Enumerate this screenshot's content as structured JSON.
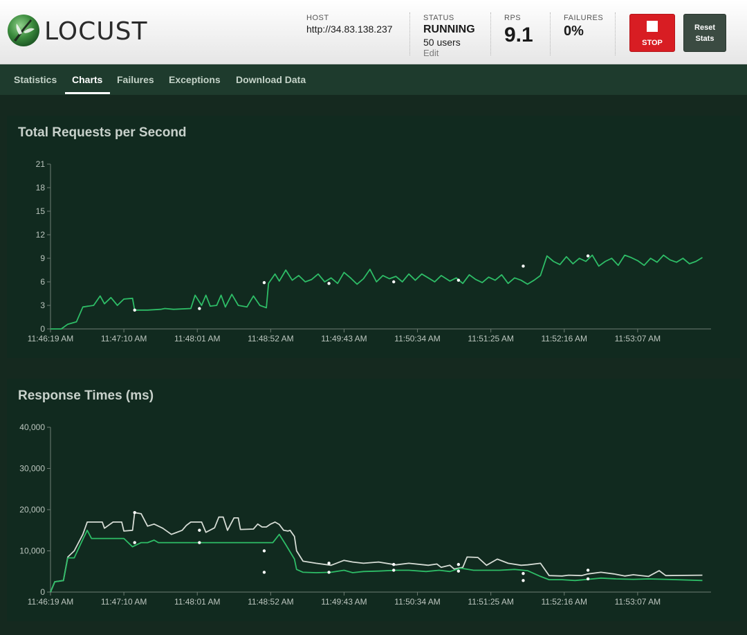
{
  "header": {
    "logo_text": "LOCUST",
    "host_label": "HOST",
    "host_value": "http://34.83.138.237",
    "status_label": "STATUS",
    "status_value": "RUNNING",
    "users_value": "50 users",
    "edit_label": "Edit",
    "rps_label": "RPS",
    "rps_value": "9.1",
    "failures_label": "FAILURES",
    "failures_value": "0%",
    "stop_label": "STOP",
    "reset_label_line1": "Reset",
    "reset_label_line2": "Stats"
  },
  "colors": {
    "rps_line": "#2ebd67",
    "median_line": "#2ebd67",
    "p95_line": "#d6dcd5",
    "stop_button": "#d81d23",
    "nav_bg": "#1e3b2d",
    "panel_bg": "#112a1f"
  },
  "nav": {
    "tabs": [
      {
        "label": "Statistics",
        "active": false
      },
      {
        "label": "Charts",
        "active": true
      },
      {
        "label": "Failures",
        "active": false
      },
      {
        "label": "Exceptions",
        "active": false
      },
      {
        "label": "Download Data",
        "active": false
      }
    ]
  },
  "chart_data": [
    {
      "type": "line",
      "title": "Total Requests per Second",
      "ylim": [
        0,
        21
      ],
      "yticks": [
        0,
        3,
        6,
        9,
        12,
        15,
        18,
        21
      ],
      "xticks": [
        "11:46:19 AM",
        "11:47:10 AM",
        "11:48:01 AM",
        "11:48:52 AM",
        "11:49:43 AM",
        "11:50:34 AM",
        "11:51:25 AM",
        "11:52:16 AM",
        "11:53:07 AM"
      ],
      "grid": false,
      "series": [
        {
          "color": "#2ebd67",
          "points": [
            [
              0,
              0
            ],
            [
              5,
              0
            ],
            [
              8,
              0.6
            ],
            [
              12,
              0.9
            ],
            [
              15,
              2.8
            ],
            [
              20,
              3.0
            ],
            [
              23,
              4.2
            ],
            [
              25,
              3.2
            ],
            [
              28,
              4.0
            ],
            [
              31,
              3.0
            ],
            [
              34,
              3.8
            ],
            [
              38,
              3.9
            ],
            [
              39,
              2.4
            ],
            [
              45,
              2.4
            ],
            [
              51,
              2.5
            ],
            [
              53,
              2.6
            ],
            [
              57,
              2.5
            ],
            [
              65,
              2.6
            ],
            [
              67,
              4.3
            ],
            [
              70,
              3.0
            ],
            [
              72,
              4.3
            ],
            [
              74,
              2.9
            ],
            [
              77,
              3.0
            ],
            [
              79,
              4.3
            ],
            [
              81,
              2.8
            ],
            [
              84,
              4.4
            ],
            [
              87,
              3.0
            ],
            [
              91,
              2.8
            ],
            [
              94,
              4.2
            ],
            [
              97,
              3.0
            ],
            [
              100,
              2.7
            ],
            [
              101,
              5.8
            ],
            [
              104,
              7.0
            ],
            [
              106,
              6.1
            ],
            [
              109,
              7.5
            ],
            [
              112,
              6.2
            ],
            [
              115,
              6.8
            ],
            [
              118,
              6.0
            ],
            [
              121,
              6.3
            ],
            [
              124,
              7.0
            ],
            [
              127,
              6.0
            ],
            [
              130,
              6.5
            ],
            [
              133,
              5.8
            ],
            [
              136,
              7.2
            ],
            [
              139,
              6.5
            ],
            [
              142,
              5.7
            ],
            [
              145,
              6.4
            ],
            [
              148,
              7.6
            ],
            [
              151,
              6.0
            ],
            [
              154,
              6.8
            ],
            [
              157,
              6.4
            ],
            [
              160,
              6.7
            ],
            [
              163,
              6.0
            ],
            [
              166,
              7.0
            ],
            [
              169,
              6.2
            ],
            [
              172,
              7.0
            ],
            [
              175,
              6.5
            ],
            [
              178,
              6.0
            ],
            [
              181,
              6.8
            ],
            [
              185,
              6.1
            ],
            [
              188,
              6.5
            ],
            [
              191,
              5.8
            ],
            [
              194,
              6.9
            ],
            [
              197,
              6.3
            ],
            [
              200,
              5.9
            ],
            [
              203,
              6.6
            ],
            [
              206,
              6.2
            ],
            [
              209,
              6.9
            ],
            [
              212,
              5.8
            ],
            [
              215,
              6.5
            ],
            [
              218,
              6.2
            ],
            [
              221,
              5.7
            ],
            [
              224,
              6.2
            ],
            [
              227,
              6.8
            ],
            [
              230,
              9.3
            ],
            [
              233,
              8.6
            ],
            [
              236,
              8.2
            ],
            [
              239,
              9.2
            ],
            [
              242,
              8.3
            ],
            [
              245,
              9.0
            ],
            [
              248,
              8.6
            ],
            [
              251,
              9.4
            ],
            [
              254,
              8.0
            ],
            [
              257,
              8.6
            ],
            [
              260,
              9.0
            ],
            [
              263,
              8.1
            ],
            [
              266,
              9.4
            ],
            [
              269,
              9.1
            ],
            [
              272,
              8.7
            ],
            [
              275,
              8.1
            ],
            [
              278,
              9.0
            ],
            [
              281,
              8.5
            ],
            [
              284,
              9.4
            ],
            [
              287,
              8.8
            ],
            [
              290,
              8.5
            ],
            [
              293,
              9.0
            ],
            [
              296,
              8.3
            ],
            [
              299,
              8.6
            ],
            [
              302,
              9.1
            ]
          ],
          "dots": [
            [
              39,
              2.4
            ],
            [
              69,
              2.6
            ],
            [
              99,
              5.9
            ],
            [
              129,
              5.8
            ],
            [
              159,
              6.0
            ],
            [
              189,
              6.2
            ],
            [
              219,
              8.0
            ],
            [
              249,
              9.3
            ]
          ]
        }
      ]
    },
    {
      "type": "line",
      "title": "Response Times (ms)",
      "ylim": [
        0,
        40000
      ],
      "yticks": [
        0,
        10000,
        20000,
        30000,
        40000
      ],
      "ytick_labels": [
        "0",
        "10,000",
        "20,000",
        "30,000",
        "40,000"
      ],
      "xticks": [
        "11:46:19 AM",
        "11:47:10 AM",
        "11:48:01 AM",
        "11:48:52 AM",
        "11:49:43 AM",
        "11:50:34 AM",
        "11:51:25 AM",
        "11:52:16 AM",
        "11:53:07 AM"
      ],
      "grid": false,
      "series": [
        {
          "color": "#d6dcd5",
          "points": [
            [
              0,
              0
            ],
            [
              2,
              2500
            ],
            [
              6,
              2800
            ],
            [
              8,
              8500
            ],
            [
              11,
              10000
            ],
            [
              15,
              14000
            ],
            [
              17,
              17000
            ],
            [
              24,
              17000
            ],
            [
              25,
              15500
            ],
            [
              29,
              17000
            ],
            [
              33,
              17000
            ],
            [
              34,
              14800
            ],
            [
              38,
              15000
            ],
            [
              39,
              19300
            ],
            [
              42,
              19000
            ],
            [
              45,
              16000
            ],
            [
              48,
              16500
            ],
            [
              52,
              15500
            ],
            [
              56,
              14000
            ],
            [
              61,
              15000
            ],
            [
              63,
              16200
            ],
            [
              65,
              17000
            ],
            [
              70,
              17000
            ],
            [
              72,
              14500
            ],
            [
              76,
              15600
            ],
            [
              78,
              18200
            ],
            [
              80,
              18200
            ],
            [
              82,
              15000
            ],
            [
              85,
              18000
            ],
            [
              87,
              18000
            ],
            [
              88,
              15200
            ],
            [
              94,
              15300
            ],
            [
              96,
              16500
            ],
            [
              98,
              15800
            ],
            [
              100,
              15800
            ],
            [
              102,
              16500
            ],
            [
              104,
              17000
            ],
            [
              106,
              16400
            ],
            [
              108,
              15000
            ],
            [
              110,
              14800
            ],
            [
              111,
              15000
            ],
            [
              113,
              13500
            ],
            [
              114,
              10000
            ],
            [
              117,
              7500
            ],
            [
              123,
              7000
            ],
            [
              130,
              6500
            ],
            [
              136,
              7700
            ],
            [
              140,
              7300
            ],
            [
              145,
              7000
            ],
            [
              152,
              7300
            ],
            [
              160,
              6600
            ],
            [
              166,
              7000
            ],
            [
              175,
              6500
            ],
            [
              179,
              6800
            ],
            [
              181,
              6000
            ],
            [
              185,
              6500
            ],
            [
              187,
              5600
            ],
            [
              191,
              6000
            ],
            [
              193,
              8500
            ],
            [
              198,
              8400
            ],
            [
              202,
              6500
            ],
            [
              207,
              8000
            ],
            [
              212,
              7000
            ],
            [
              218,
              6500
            ],
            [
              221,
              6600
            ],
            [
              227,
              7000
            ],
            [
              231,
              4000
            ],
            [
              237,
              3900
            ],
            [
              240,
              4100
            ],
            [
              246,
              4000
            ],
            [
              249,
              4400
            ],
            [
              255,
              4800
            ],
            [
              261,
              4400
            ],
            [
              266,
              3900
            ],
            [
              270,
              4200
            ],
            [
              277,
              3800
            ],
            [
              282,
              5200
            ],
            [
              285,
              4000
            ],
            [
              302,
              4100
            ]
          ],
          "dots": [
            [
              39,
              19300
            ],
            [
              69,
              15000
            ],
            [
              99,
              10000
            ],
            [
              129,
              7000
            ],
            [
              159,
              6700
            ],
            [
              189,
              6700
            ],
            [
              219,
              4500
            ],
            [
              249,
              5300
            ]
          ]
        },
        {
          "color": "#2ebd67",
          "points": [
            [
              0,
              0
            ],
            [
              2,
              2500
            ],
            [
              6,
              2800
            ],
            [
              8,
              8300
            ],
            [
              11,
              8300
            ],
            [
              15,
              12800
            ],
            [
              17,
              15000
            ],
            [
              19,
              13000
            ],
            [
              24,
              13000
            ],
            [
              29,
              13000
            ],
            [
              34,
              13000
            ],
            [
              38,
              11000
            ],
            [
              42,
              12000
            ],
            [
              45,
              12000
            ],
            [
              48,
              12600
            ],
            [
              50,
              12000
            ],
            [
              55,
              12000
            ],
            [
              62,
              12000
            ],
            [
              66,
              12000
            ],
            [
              70,
              12000
            ],
            [
              77,
              12000
            ],
            [
              86,
              12000
            ],
            [
              93,
              12000
            ],
            [
              100,
              12000
            ],
            [
              103,
              12000
            ],
            [
              106,
              14000
            ],
            [
              109,
              11500
            ],
            [
              113,
              8000
            ],
            [
              114,
              5500
            ],
            [
              117,
              4800
            ],
            [
              123,
              4700
            ],
            [
              130,
              4800
            ],
            [
              136,
              5300
            ],
            [
              140,
              4700
            ],
            [
              145,
              5000
            ],
            [
              152,
              5100
            ],
            [
              160,
              5300
            ],
            [
              166,
              5300
            ],
            [
              174,
              5000
            ],
            [
              180,
              5300
            ],
            [
              185,
              5000
            ],
            [
              190,
              5800
            ],
            [
              196,
              5300
            ],
            [
              202,
              5300
            ],
            [
              208,
              5300
            ],
            [
              215,
              5500
            ],
            [
              221,
              5200
            ],
            [
              227,
              3800
            ],
            [
              231,
              3000
            ],
            [
              237,
              3000
            ],
            [
              243,
              2800
            ],
            [
              249,
              3100
            ],
            [
              255,
              3400
            ],
            [
              262,
              3200
            ],
            [
              270,
              3100
            ],
            [
              277,
              3200
            ],
            [
              285,
              3100
            ],
            [
              302,
              2800
            ]
          ],
          "dots": [
            [
              39,
              12000
            ],
            [
              69,
              12000
            ],
            [
              99,
              4800
            ],
            [
              129,
              4800
            ],
            [
              159,
              5300
            ],
            [
              189,
              5100
            ],
            [
              219,
              2800
            ],
            [
              249,
              3200
            ]
          ]
        }
      ]
    }
  ]
}
